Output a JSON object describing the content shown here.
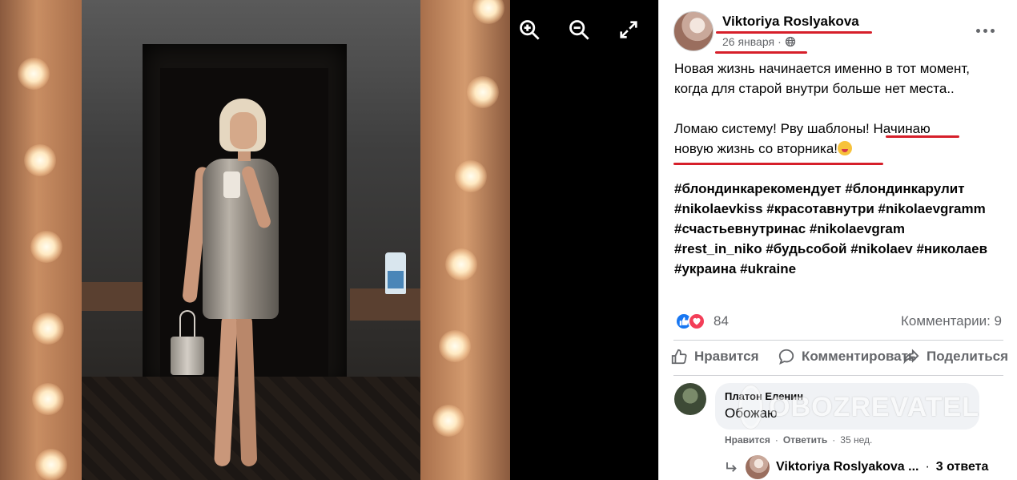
{
  "viewer": {
    "tools": [
      "zoom-in-icon",
      "zoom-out-icon",
      "fullscreen-icon"
    ]
  },
  "post": {
    "author": "Viktoriya Roslyakova",
    "date": "26 января",
    "separator": "·",
    "privacy_icon": "globe-icon",
    "more_icon": "more-options-icon",
    "text_lines": [
      "Новая жизнь начинается именно в тот момент,",
      "когда для старой внутри больше нет места..",
      "Ломаю систему! Рву шаблоны! Начинаю",
      "новую жизнь со вторника!"
    ],
    "hashtag_lines": [
      "#блондинкарекомендует #блондинкарулит",
      "#nikolaevkiss #красотавнутри #nikolaevgramm",
      "#счастьевнутринас #nikolaevgram",
      "#rest_in_niko #будьсобой #nikolaev #николаев",
      "#украина #ukraine"
    ],
    "reaction_count": "84",
    "comments_label": "Комментарии: 9",
    "actions": {
      "like": "Нравится",
      "comment": "Комментировать",
      "share": "Поделиться"
    }
  },
  "comment": {
    "name": "Платон Еленин",
    "text": "Обожаю",
    "like": "Нравится",
    "dot": "·",
    "reply": "Ответить",
    "time": "35 нед.",
    "reply_preview": {
      "name": "Viktoriya Roslyakova ...",
      "dot": "·",
      "count": "3 ответа"
    }
  },
  "watermark": {
    "text": "OBOZREVATEL"
  },
  "colors": {
    "accent_underline": "#d61f2a",
    "like_blue": "#1877f2",
    "love_red": "#f33e58",
    "secondary_text": "#65676b"
  }
}
